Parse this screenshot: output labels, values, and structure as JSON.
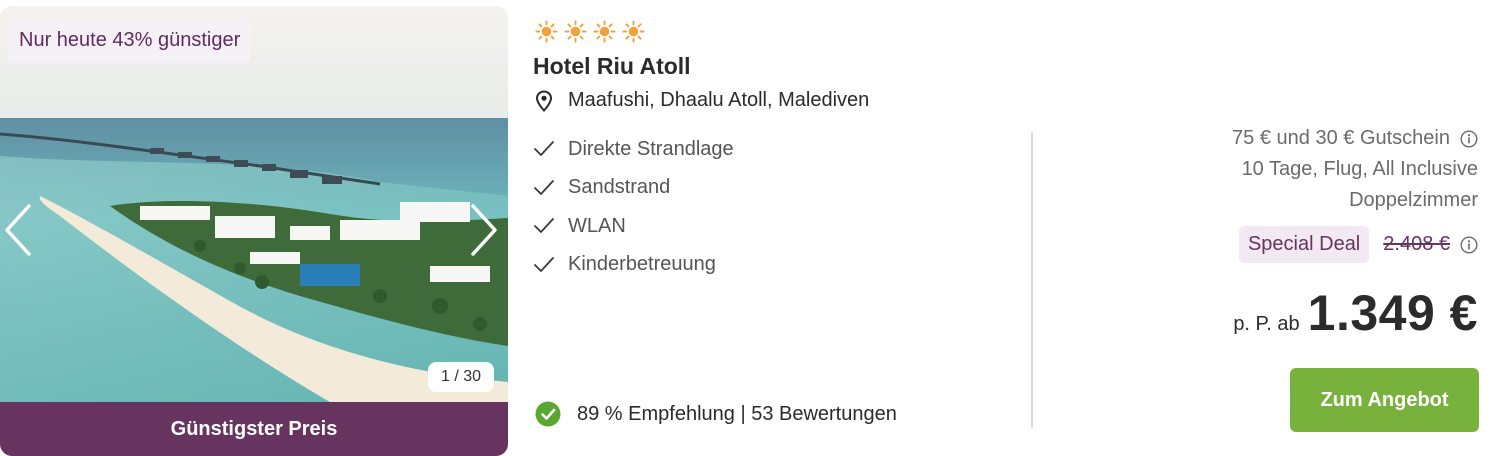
{
  "media": {
    "badge_text": "Nur heute 43% günstiger",
    "counter_text": "1 / 30",
    "cheapest_label": "Günstigster Preis",
    "prev_icon": "chevron-left-icon",
    "next_icon": "chevron-right-icon"
  },
  "hotel": {
    "stars": 4,
    "star_icon": "sun-icon",
    "star_color": "#f2a23a",
    "name": "Hotel Riu Atoll",
    "location": "Maafushi, Dhaalu Atoll, Malediven",
    "location_icon": "map-pin-icon",
    "features": [
      "Direkte Strandlage",
      "Sandstrand",
      "WLAN",
      "Kinderbetreuung"
    ],
    "feature_icon": "checkmark-icon",
    "rating_text": "89 % Empfehlung | 53 Bewertungen",
    "rating_icon": "check-circle-icon",
    "rating_color": "#5aa832"
  },
  "offer": {
    "voucher": "75 € und 30 € Gutschein",
    "trip": "10 Tage, Flug, All Inclusive",
    "room": "Doppelzimmer",
    "deal_badge": "Special Deal",
    "old_price": "2.408 €",
    "price_prefix": "p. P. ab",
    "price": "1.349 €",
    "cta_label": "Zum Angebot",
    "cta_color": "#79b13d",
    "brand_color": "#66345f"
  }
}
